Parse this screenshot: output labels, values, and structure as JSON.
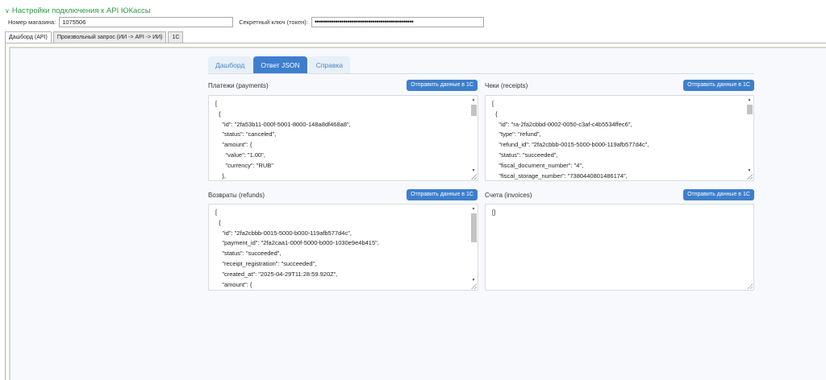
{
  "connection": {
    "header": "Настройки подключения к API ЮКассы",
    "shop_label": "Номер магазина:",
    "shop_value": "1075506",
    "key_label": "Секретный ключ (токен):",
    "key_value": "••••••••••••••••••••••••••••••••••••••••••••••••"
  },
  "main_tabs": [
    {
      "label": "Дашборд (API)",
      "active": true
    },
    {
      "label": "Произвольный запрос (ИИ -> API -> ИИ)",
      "active": false
    },
    {
      "label": "1С",
      "active": false
    }
  ],
  "sub_tabs": [
    {
      "label": "Дашборд",
      "active": false
    },
    {
      "label": "Ответ JSON",
      "active": true
    },
    {
      "label": "Справка",
      "active": false
    }
  ],
  "send_label": "Отправить данные в 1С",
  "panels": {
    "payments": {
      "title": "Платежи (payments)",
      "content": "[\n  {\n    \"id\": \"2fa53b11-000f-5001-8000-148a8df468a8\",\n    \"status\": \"canceled\",\n    \"amount\": {\n      \"value\": \"1.00\",\n      \"currency\": \"RUB\"\n    },"
    },
    "receipts": {
      "title": "Чеки (receipts)",
      "content": "[\n  {\n    \"id\": \"ra-2fa2cbbd-0002-0050-c3af-c4b5534ffec6\",\n    \"type\": \"refund\",\n    \"refund_id\": \"2fa2cbbb-0015-5000-b000-119afb577d4c\",\n    \"status\": \"succeeded\",\n    \"fiscal_document_number\": \"4\",\n    \"fiscal_storage_number\": \"7380440801486174\","
    },
    "refunds": {
      "title": "Возвраты (refunds)",
      "content": "[\n  {\n    \"id\": \"2fa2cbbb-0015-5000-b000-119afb577d4c\",\n    \"payment_id\": \"2fa2caa1-000f-5000-b000-1030e9e4b415\",\n    \"status\": \"succeeded\",\n    \"receipt_registration\": \"succeeded\",\n    \"created_at\": \"2025-04-29T11:28:59.920Z\",\n    \"amount\": {"
    },
    "invoices": {
      "title": "Счета (invoices)",
      "content": "[]"
    }
  }
}
